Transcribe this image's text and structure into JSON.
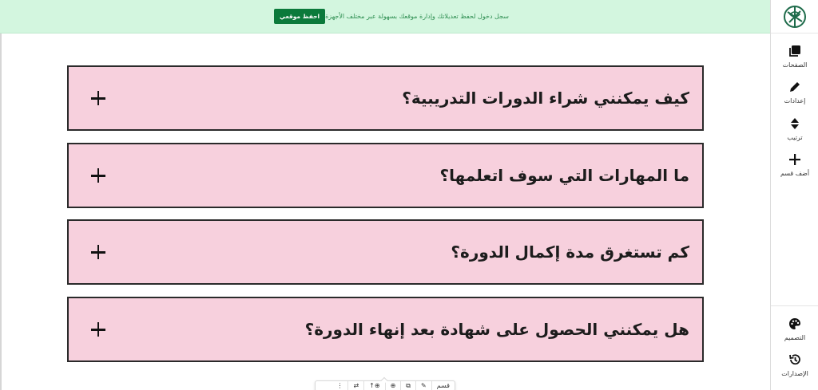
{
  "banner": {
    "text": "سجل دخول لحفظ تعديلاتك وإدارة موقعك بسهولة عبر مختلف الأجهزة",
    "button_label": "احفظ موقعي"
  },
  "sidebar": {
    "items": [
      {
        "label": "الصفحات",
        "icon": "pages-icon"
      },
      {
        "label": "إعدادات",
        "icon": "pencil-icon"
      },
      {
        "label": "ترتيب",
        "icon": "sort-icon"
      },
      {
        "label": "أضف قسم",
        "icon": "plus-icon"
      },
      {
        "label": "التصميم",
        "icon": "palette-icon"
      },
      {
        "label": "الإصدارات",
        "icon": "history-icon"
      }
    ]
  },
  "faq": {
    "items": [
      {
        "question": "كيف يمكنني شراء الدورات التدريبية؟"
      },
      {
        "question": "ما المهارات التي سوف اتعلمها؟"
      },
      {
        "question": "كم تستغرق مدة إكمال الدورة؟"
      },
      {
        "question": "هل يمكنني الحصول على شهادة بعد إنهاء الدورة؟"
      }
    ]
  },
  "toolbar": {
    "items": [
      "قسم",
      "✎",
      "⧉",
      "⊕",
      "⊕↑",
      "⇄",
      "⋮"
    ]
  },
  "colors": {
    "banner_bg": "#d3f6df",
    "banner_button": "#0b7a3b",
    "faq_bg": "#f7d0dd",
    "faq_border": "#2a2a2a",
    "logo_green": "#1e6b4a"
  }
}
